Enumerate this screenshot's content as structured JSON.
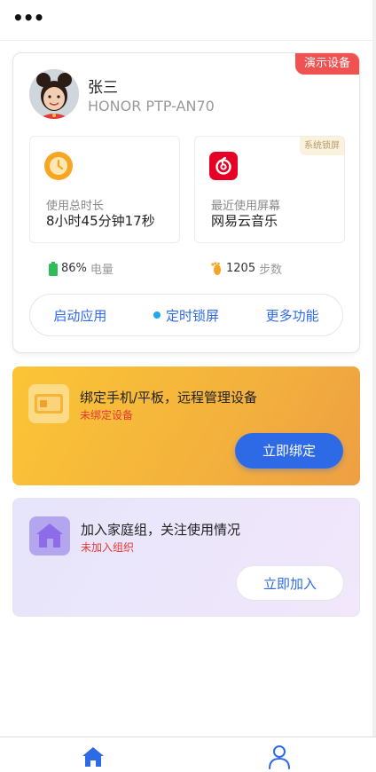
{
  "topbar": {
    "more_label": "•••"
  },
  "device": {
    "badge": "演示设备",
    "user_name": "张三",
    "model": "HONOR PTP-AN70",
    "usage": {
      "label": "使用总时长",
      "value": "8小时45分钟17秒",
      "icon": "clock-icon"
    },
    "recent": {
      "label": "最近使用屏幕",
      "value": "网易云音乐",
      "icon": "netease-music-icon",
      "badge": "系统锁屏"
    },
    "battery": {
      "value": "86%",
      "unit": "电量",
      "level": 0.86
    },
    "steps": {
      "value": "1205",
      "unit": "步数"
    },
    "actions": [
      {
        "label": "启动应用"
      },
      {
        "label": "定时锁屏"
      },
      {
        "label": "更多功能"
      }
    ]
  },
  "bind": {
    "title": "绑定手机/平板，远程管理设备",
    "subtitle": "未绑定设备",
    "button": "立即绑定"
  },
  "family": {
    "title": "加入家庭组，关注使用情况",
    "subtitle": "未加入组织",
    "button": "立即加入"
  },
  "tabs": [
    {
      "icon": "home-icon",
      "active": true
    },
    {
      "icon": "profile-icon",
      "active": false
    }
  ],
  "colors": {
    "accent": "#2f6ae6",
    "danger": "#f05151",
    "bind_card": "#f8bb3a",
    "family_card": "#ebe6fb"
  }
}
